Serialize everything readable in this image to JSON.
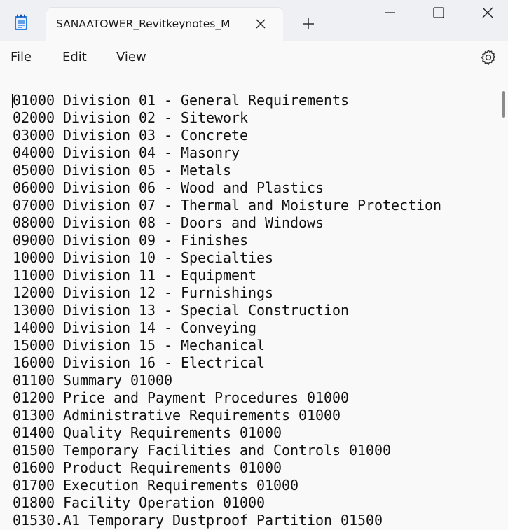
{
  "window": {
    "tab_title": "SANAATOWER_Revitkeynotes_M",
    "colors": {
      "accent": "#1f6fd1",
      "titlebar": "#eef0f3",
      "editor_bg": "#f9f9f9"
    }
  },
  "icons": {
    "app": "notepad-icon",
    "tab_close": "close-icon",
    "new_tab": "plus-icon",
    "minimize": "minimize-icon",
    "maximize": "maximize-icon",
    "close": "close-icon",
    "settings": "gear-icon"
  },
  "menu": {
    "items": [
      {
        "label": "File"
      },
      {
        "label": "Edit"
      },
      {
        "label": "View"
      }
    ]
  },
  "editor": {
    "lines": [
      "01000 Division 01 - General Requirements",
      "02000 Division 02 - Sitework",
      "03000 Division 03 - Concrete",
      "04000 Division 04 - Masonry",
      "05000 Division 05 - Metals",
      "06000 Division 06 - Wood and Plastics",
      "07000 Division 07 - Thermal and Moisture Protection",
      "08000 Division 08 - Doors and Windows",
      "09000 Division 09 - Finishes",
      "10000 Division 10 - Specialties",
      "11000 Division 11 - Equipment",
      "12000 Division 12 - Furnishings",
      "13000 Division 13 - Special Construction",
      "14000 Division 14 - Conveying",
      "15000 Division 15 - Mechanical",
      "16000 Division 16 - Electrical",
      "01100 Summary 01000",
      "01200 Price and Payment Procedures 01000",
      "01300 Administrative Requirements 01000",
      "01400 Quality Requirements 01000",
      "01500 Temporary Facilities and Controls 01000",
      "01600 Product Requirements 01000",
      "01700 Execution Requirements 01000",
      "01800 Facility Operation 01000",
      "01530.A1 Temporary Dustproof Partition 01500"
    ]
  }
}
